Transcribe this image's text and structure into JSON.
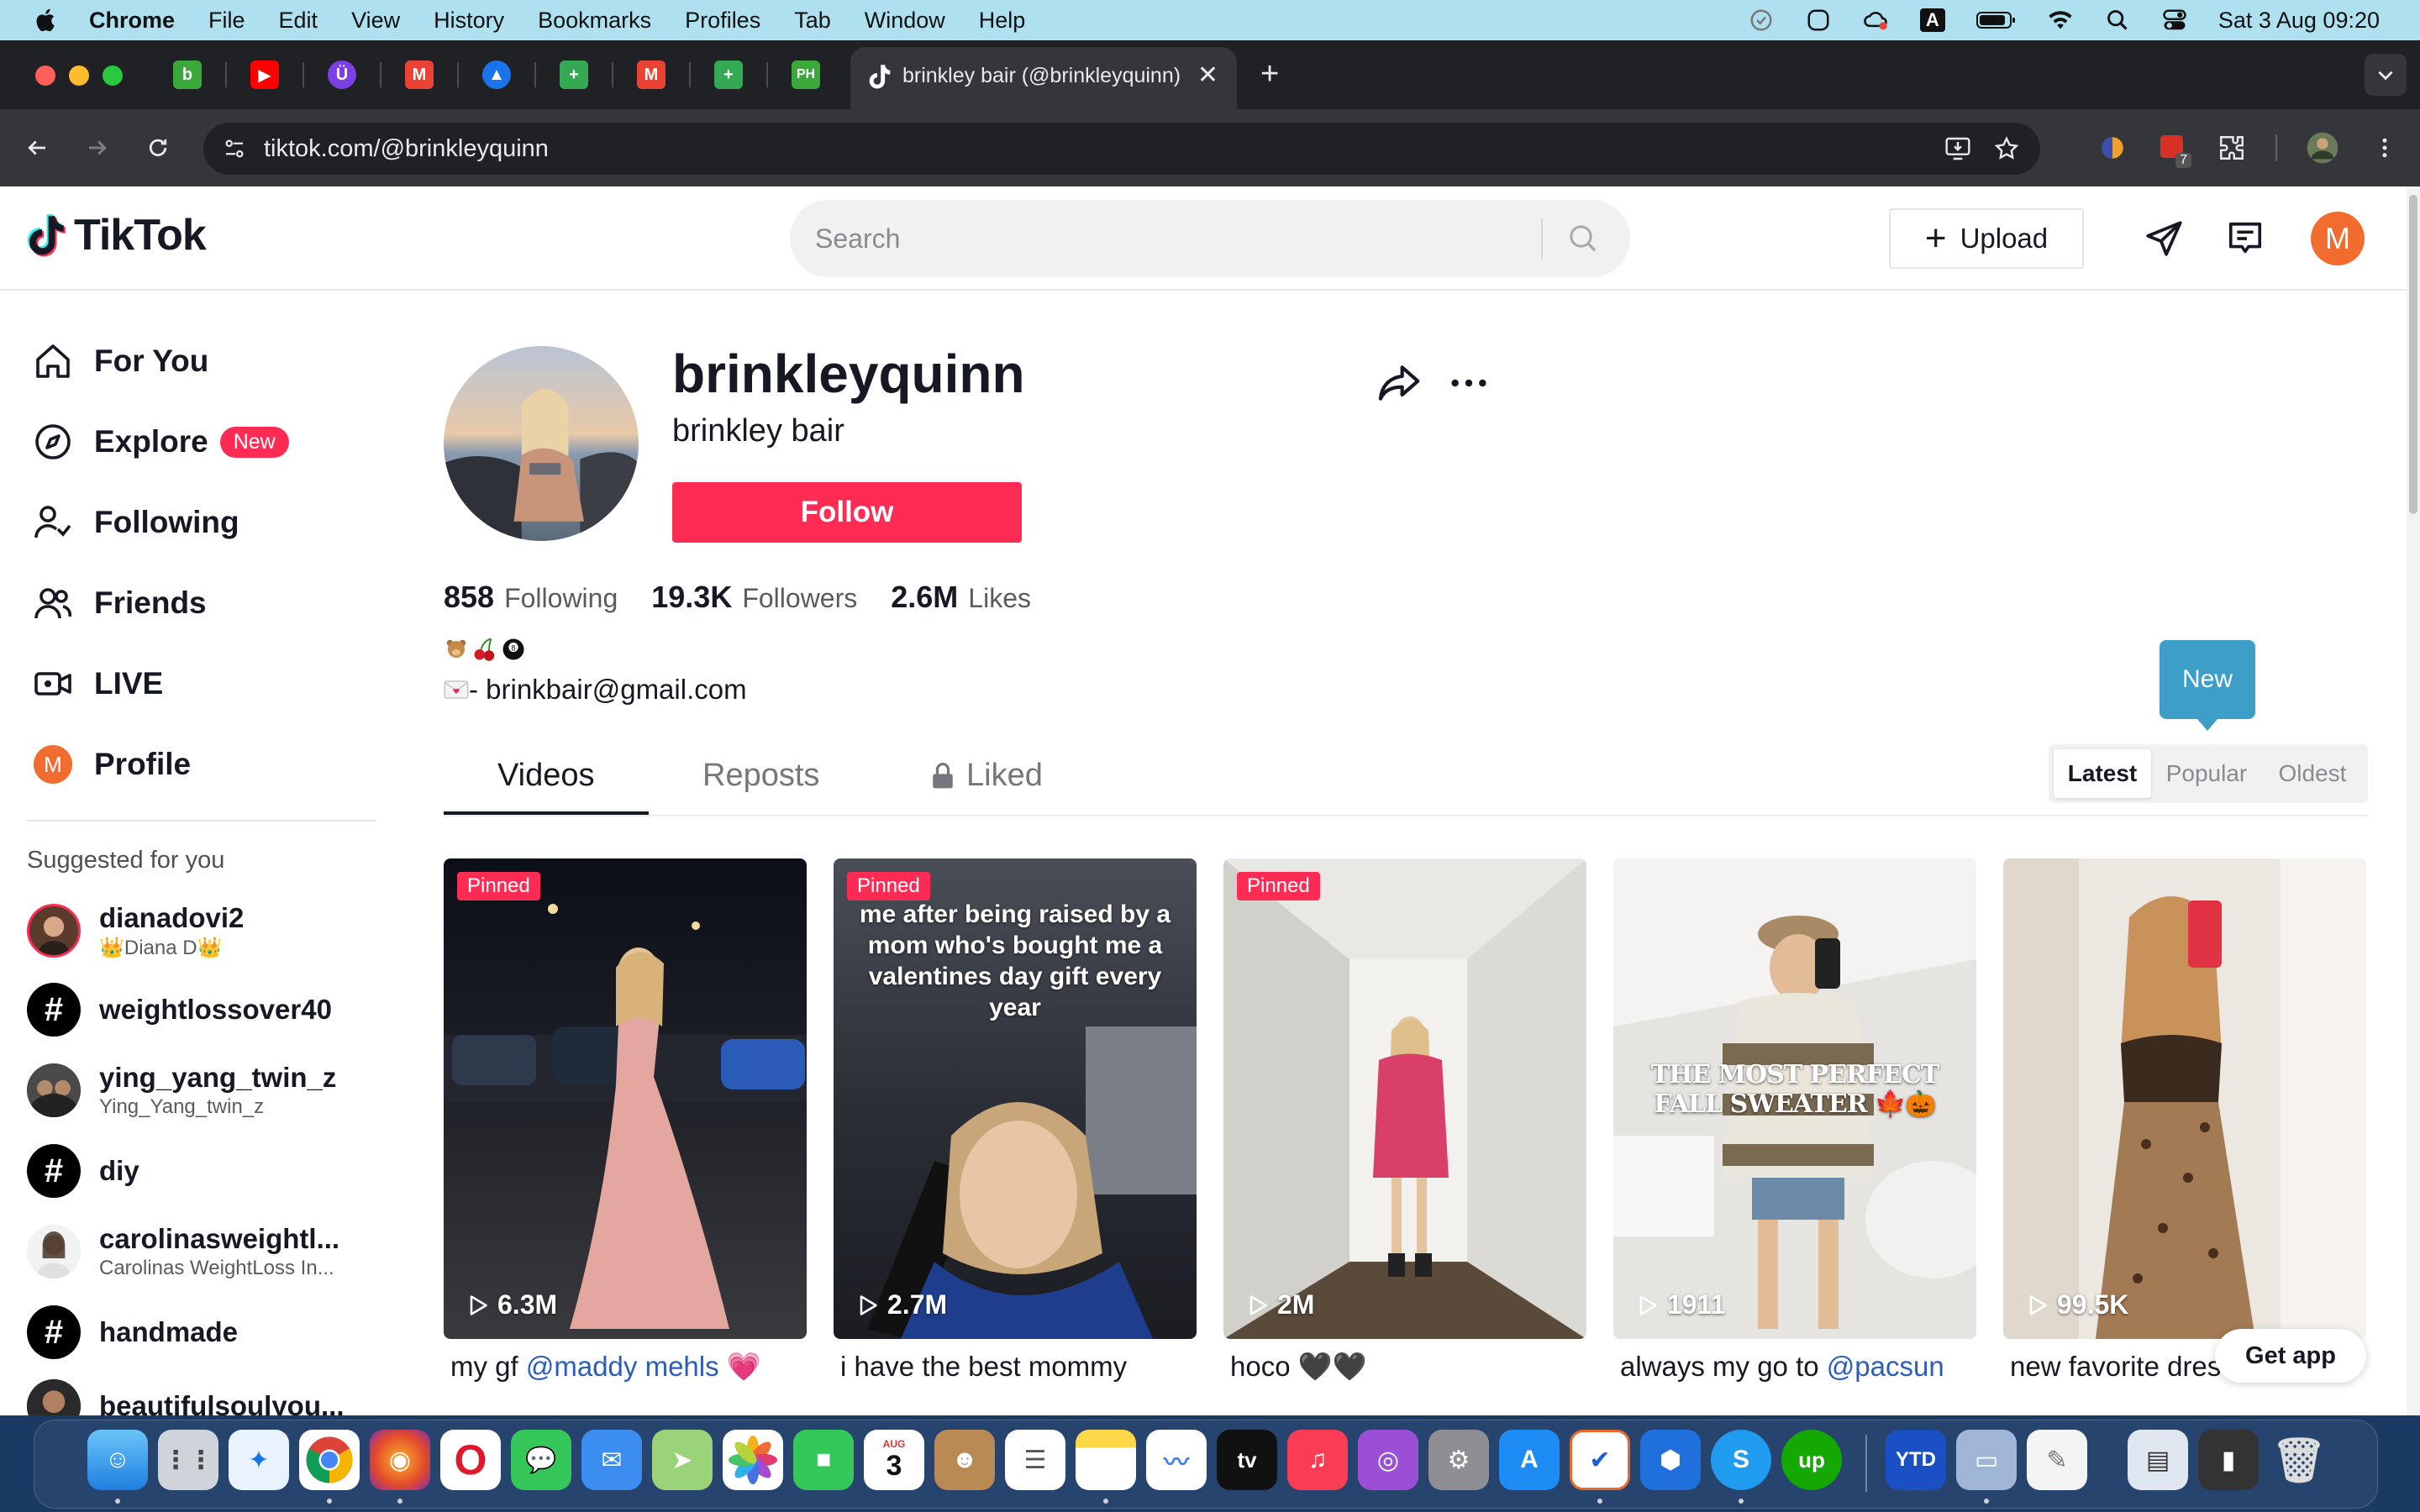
{
  "menubar": {
    "app_name": "Chrome",
    "items": [
      "File",
      "Edit",
      "View",
      "History",
      "Bookmarks",
      "Profiles",
      "Tab",
      "Window",
      "Help"
    ],
    "input_source": "A",
    "clock": "Sat 3 Aug  09:20"
  },
  "browser": {
    "active_tab_title": "brinkley bair (@brinkleyquinn)",
    "new_tab": "+",
    "tab_close": "✕",
    "pinned_tabs": [
      {
        "label": "b",
        "color": "#3aa83a"
      },
      {
        "label": "▶",
        "color": "#ff0000"
      },
      {
        "label": "Ü",
        "color": "#7b3fe4"
      },
      {
        "label": "M",
        "color": "#ea4335"
      },
      {
        "label": "▲",
        "color": "#1a73e8"
      },
      {
        "label": "+",
        "color": "#34a853"
      },
      {
        "label": "M",
        "color": "#ea4335"
      },
      {
        "label": "+",
        "color": "#34a853"
      },
      {
        "label": "PH",
        "color": "#3aa83a"
      }
    ],
    "url": "tiktok.com/@brinkleyquinn",
    "extension_badge": "7"
  },
  "tiktok": {
    "logo_text": "TikTok",
    "search_placeholder": "Search",
    "upload_label": "Upload",
    "avatar_initial": "M",
    "nav": {
      "for_you": "For You",
      "explore": "Explore",
      "explore_badge": "New",
      "following": "Following",
      "friends": "Friends",
      "live": "LIVE",
      "profile": "Profile"
    },
    "suggested_title": "Suggested for you",
    "suggested": [
      {
        "name": "dianadovi2",
        "sub": "👑Diana D👑"
      },
      {
        "name": "weightlossover40",
        "sub": ""
      },
      {
        "name": "ying_yang_twin_z",
        "sub": "Ying_Yang_twin_z"
      },
      {
        "name": "diy",
        "sub": ""
      },
      {
        "name": "carolinasweightl...",
        "sub": "Carolinas WeightLoss In..."
      },
      {
        "name": "handmade",
        "sub": ""
      },
      {
        "name": "beautifulsoulyou...",
        "sub": ""
      }
    ],
    "hashtag_symbol": "#"
  },
  "profile": {
    "username": "brinkleyquinn",
    "nickname": "brinkley bair",
    "follow_label": "Follow",
    "stats": {
      "following": "858",
      "following_label": "Following",
      "followers": "19.3K",
      "followers_label": "Followers",
      "likes": "2.6M",
      "likes_label": "Likes"
    },
    "bio_email": "- brinkbair@gmail.com",
    "tabs": {
      "videos": "Videos",
      "reposts": "Reposts",
      "liked": "Liked"
    },
    "sort": {
      "latest": "Latest",
      "popular": "Popular",
      "oldest": "Oldest"
    },
    "new_tooltip": "New",
    "get_app": "Get app"
  },
  "videos": [
    {
      "pinned": "Pinned",
      "plays": "6.3M",
      "caption": "my gf ",
      "mention": "@maddy mehls",
      "tail": " 💗",
      "overlay": ""
    },
    {
      "pinned": "Pinned",
      "plays": "2.7M",
      "caption": "i have the best mommy",
      "mention": "",
      "tail": "",
      "overlay": "me after being raised by a mom who's bought me a valentines day gift every year"
    },
    {
      "pinned": "Pinned",
      "plays": "2M",
      "caption": "hoco 🖤🖤",
      "mention": "",
      "tail": "",
      "overlay": ""
    },
    {
      "pinned": "",
      "plays": "1911",
      "caption": "always my go to ",
      "mention": "@pacsun",
      "tail": "",
      "overlay": "THE MOST PERFECT FALL SWEATER 🍁🎃"
    },
    {
      "pinned": "",
      "plays": "99.5K",
      "caption": "new favorite dress",
      "mention": "",
      "tail": "",
      "overlay": ""
    }
  ]
}
